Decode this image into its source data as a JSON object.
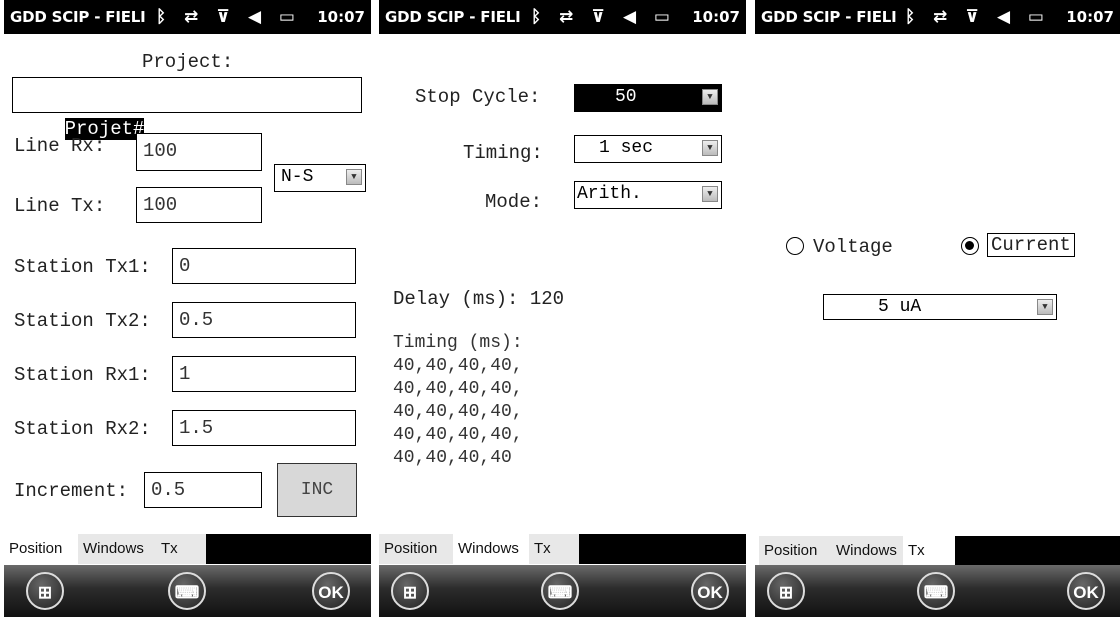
{
  "statusbar": {
    "title": "GDD SCIP - FIELI",
    "icons": "ᛒ ⇄ ⊽ ◀ ▭",
    "time": "10:07"
  },
  "tabs": [
    "Position",
    "Windows",
    "Tx"
  ],
  "softkeys": {
    "start": "⊞",
    "keyboard": "⌨",
    "ok": "OK"
  },
  "position": {
    "project_label": "Project:",
    "project_value": "Projet#",
    "line_rx_label": "Line Rx:",
    "line_rx_value": "100",
    "line_tx_label": "Line Tx:",
    "line_tx_value": "100",
    "direction_value": "N-S",
    "station_tx1_label": "Station Tx1:",
    "station_tx1_value": "0",
    "station_tx2_label": "Station Tx2:",
    "station_tx2_value": "0.5",
    "station_rx1_label": "Station Rx1:",
    "station_rx1_value": "1",
    "station_rx2_label": "Station Rx2:",
    "station_rx2_value": "1.5",
    "increment_label": "Increment:",
    "increment_value": "0.5",
    "inc_button": "INC"
  },
  "windows": {
    "stop_cycle_label": "Stop Cycle:",
    "stop_cycle_value": "50",
    "timing_label": "Timing:",
    "timing_value": "1 sec",
    "mode_label": "Mode:",
    "mode_value": "Arith.",
    "delay_text": "Delay (ms): 120",
    "timing_ms_text": "Timing (ms):\n40,40,40,40,\n40,40,40,40,\n40,40,40,40,\n40,40,40,40,\n40,40,40,40"
  },
  "tx": {
    "voltage_label": "Voltage",
    "current_label": "Current",
    "current_value": "5 uA"
  },
  "colors": {
    "statusbar": "#000000",
    "selected_dropdown": "#000000",
    "inc_button": "#d8d8d8"
  }
}
